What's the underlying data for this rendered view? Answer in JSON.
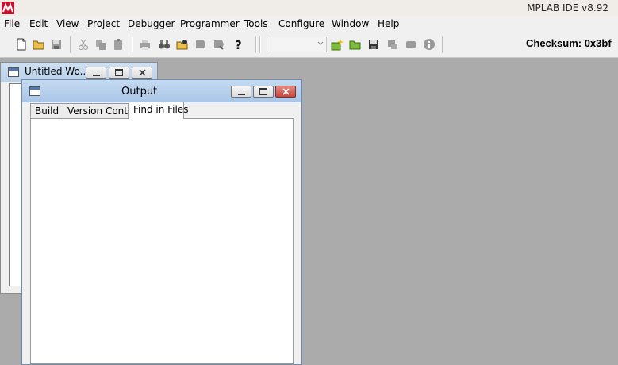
{
  "app": {
    "title": "MPLAB IDE v8.92"
  },
  "menu": [
    "File",
    "Edit",
    "View",
    "Project",
    "Debugger",
    "Programmer",
    "Tools",
    "Configure",
    "Window",
    "Help"
  ],
  "toolbar": {
    "checksum_label": "Checksum:  0x3bf"
  },
  "workspace": {
    "title": "Untitled Wo..."
  },
  "output": {
    "title": "Output",
    "tabs": [
      "Build",
      "Version Control",
      "Find in Files"
    ],
    "active_tab": "Find in Files"
  },
  "colors": {
    "desktop": "#ababab",
    "title_active": "#a9c6e8",
    "close_button": "#c9463d"
  }
}
